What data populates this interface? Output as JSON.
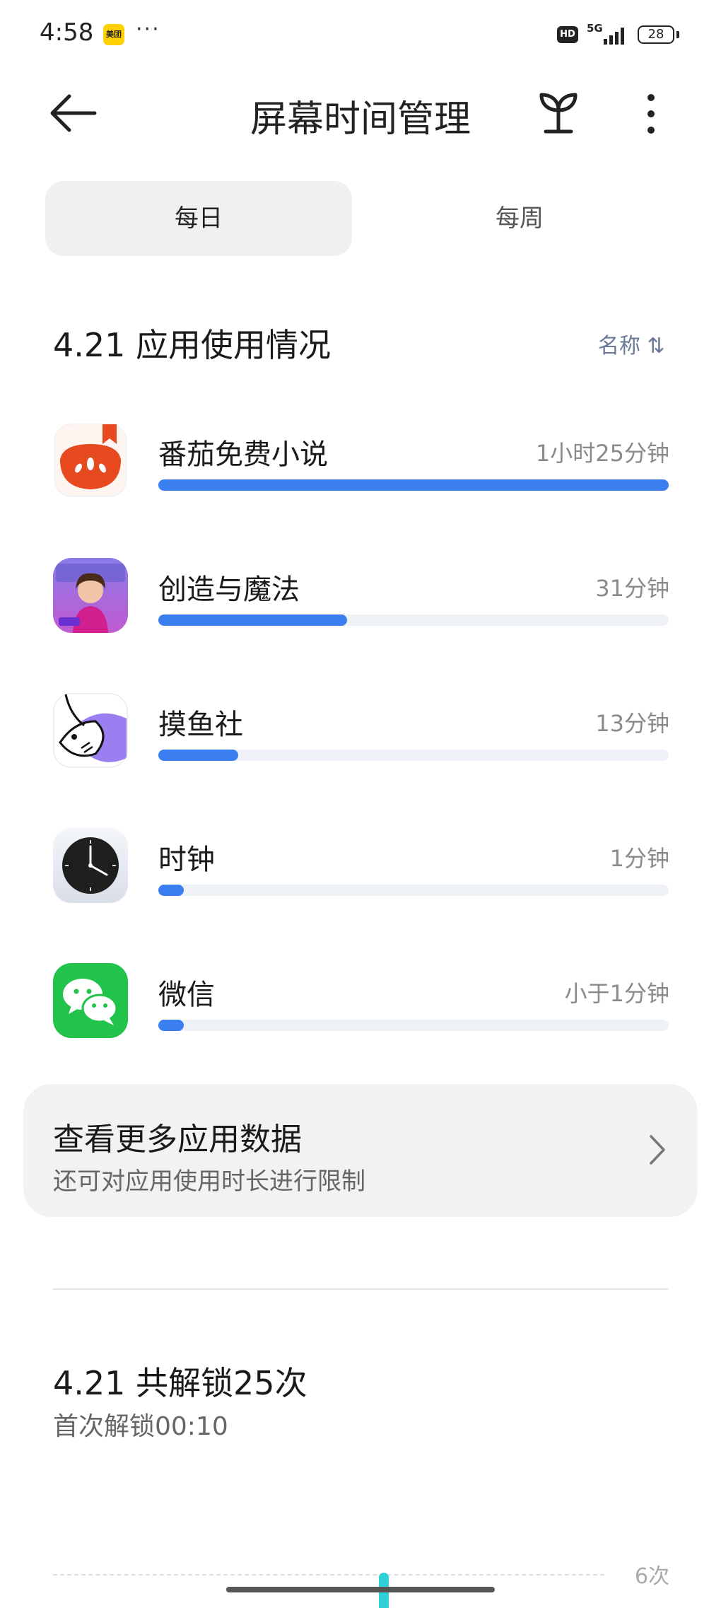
{
  "status_bar": {
    "time": "4:58",
    "meituan_label": "美团",
    "dots": "···",
    "hd": "HD",
    "network": "5G",
    "battery": "28"
  },
  "header": {
    "title": "屏幕时间管理"
  },
  "tabs": [
    {
      "label": "每日",
      "selected": true
    },
    {
      "label": "每周",
      "selected": false
    }
  ],
  "usage": {
    "title": "4.21 应用使用情况",
    "sort_label": "名称 ⇅",
    "apps": [
      {
        "name": "番茄免费小说",
        "time": "1小时25分钟",
        "fraction": 1.0,
        "icon": "fanqie-novel-icon"
      },
      {
        "name": "创造与魔法",
        "time": "31分钟",
        "fraction": 0.37,
        "icon": "create-magic-icon"
      },
      {
        "name": "摸鱼社",
        "time": "13分钟",
        "fraction": 0.157,
        "icon": "moyushe-icon"
      },
      {
        "name": "时钟",
        "time": "1分钟",
        "fraction": 0.05,
        "icon": "clock-icon"
      },
      {
        "name": "微信",
        "time": "小于1分钟",
        "fraction": 0.05,
        "icon": "wechat-icon"
      }
    ],
    "bar_color": "#3a7ef0"
  },
  "more_card": {
    "title": "查看更多应用数据",
    "subtitle": "还可对应用使用时长进行限制"
  },
  "unlock": {
    "title": "4.21 共解锁25次",
    "subtitle": "首次解锁00:10",
    "chart_max_label": "6次"
  }
}
